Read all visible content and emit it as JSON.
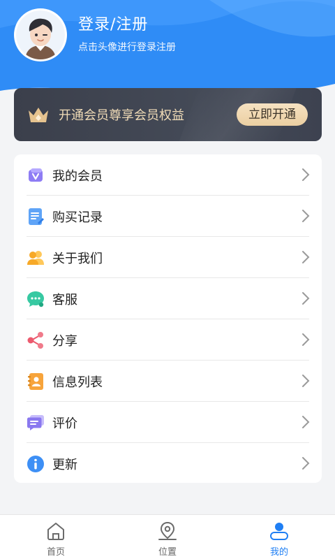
{
  "header": {
    "login_title": "登录/注册",
    "login_subtitle": "点击头像进行登录注册"
  },
  "vip": {
    "text": "开通会员尊享会员权益",
    "button": "立即开通"
  },
  "menu": [
    {
      "label": "我的会员",
      "icon": "vip-icon"
    },
    {
      "label": "购买记录",
      "icon": "document-icon"
    },
    {
      "label": "关于我们",
      "icon": "users-icon"
    },
    {
      "label": "客服",
      "icon": "chat-icon"
    },
    {
      "label": "分享",
      "icon": "share-icon"
    },
    {
      "label": "信息列表",
      "icon": "contacts-icon"
    },
    {
      "label": "评价",
      "icon": "comment-icon"
    },
    {
      "label": "更新",
      "icon": "info-icon"
    }
  ],
  "tabs": [
    {
      "label": "首页",
      "icon": "home-icon"
    },
    {
      "label": "位置",
      "icon": "location-icon"
    },
    {
      "label": "我的",
      "icon": "profile-icon",
      "active": true
    }
  ],
  "colors": {
    "primary": "#1f7ff4",
    "header_blue": "#2f8cf6",
    "vip_dark": "#3f4450",
    "vip_gold": "#f1dcb7"
  }
}
